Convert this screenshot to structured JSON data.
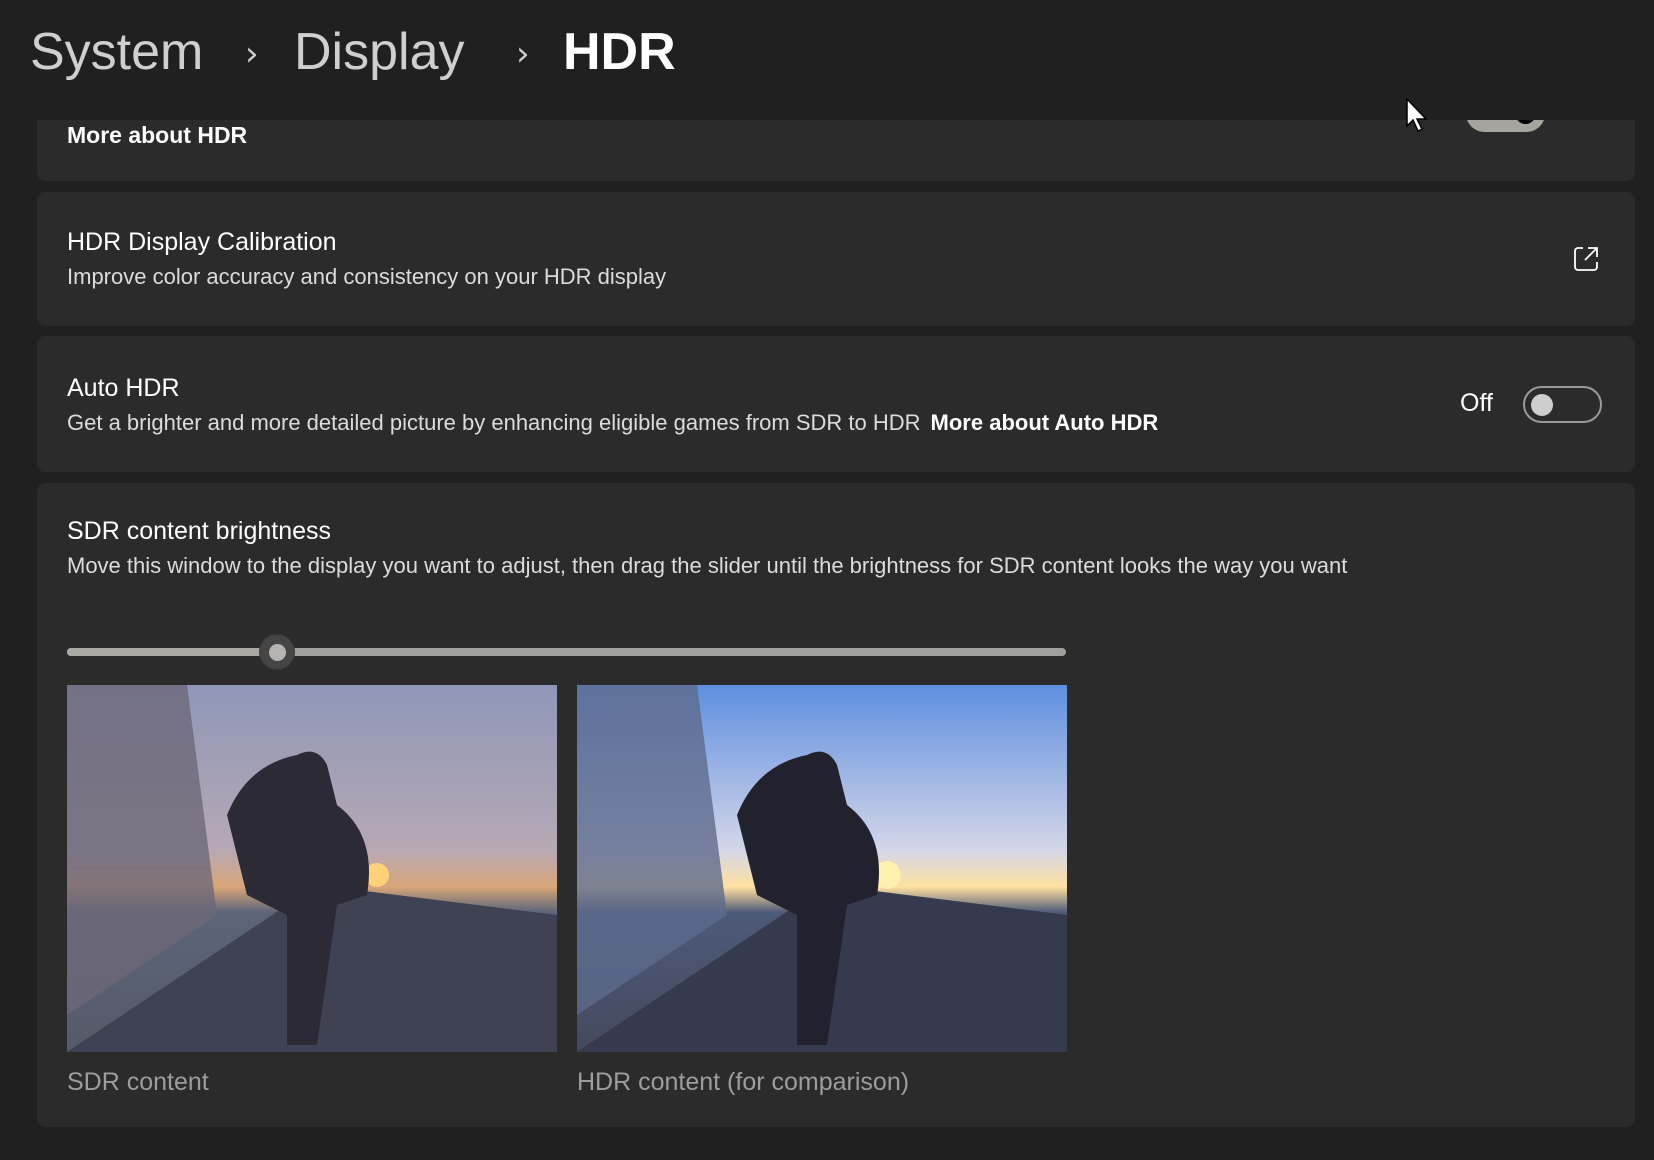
{
  "breadcrumb": {
    "items": [
      "System",
      "Display",
      "HDR"
    ],
    "separator": "›"
  },
  "hdr_card": {
    "link": "More about HDR",
    "toggle_on": true
  },
  "calibration": {
    "title": "HDR Display Calibration",
    "subtitle": "Improve color accuracy and consistency on your HDR display",
    "icon": "open-external-icon"
  },
  "auto_hdr": {
    "title": "Auto HDR",
    "subtitle": "Get a brighter and more detailed picture by enhancing eligible games from SDR to HDR",
    "link": "More about Auto HDR",
    "state": "Off",
    "toggle_on": false
  },
  "sdr_brightness": {
    "title": "SDR content brightness",
    "subtitle": "Move this window to the display you want to adjust, then drag the slider until the brightness for SDR content looks the way you want",
    "slider_value": 0.21,
    "captions": [
      "SDR content",
      "HDR content (for comparison)"
    ]
  }
}
